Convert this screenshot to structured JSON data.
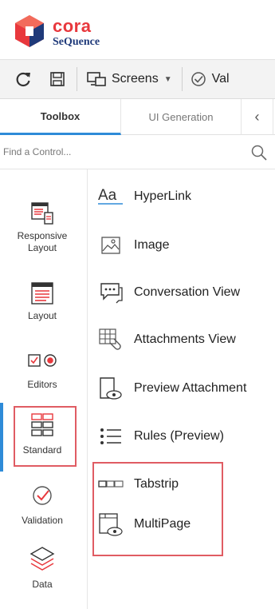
{
  "brand": {
    "name_top": "cora",
    "name_bottom": "SeQuence",
    "logo_color": "#e8383d",
    "name_bottom_color": "#1f3a7a"
  },
  "toolbar": {
    "refresh_icon": "refresh-icon",
    "save_icon": "save-icon",
    "screens_label": "Screens",
    "validate_label": "Val"
  },
  "tabs": [
    {
      "label": "Toolbox",
      "active": true
    },
    {
      "label": "UI Generation",
      "active": false
    }
  ],
  "search": {
    "placeholder": "Find a Control..."
  },
  "categories": [
    {
      "label": "Responsive Layout",
      "icon": "responsive-layout-icon"
    },
    {
      "label": "Layout",
      "icon": "layout-icon"
    },
    {
      "label": "Editors",
      "icon": "editors-icon"
    },
    {
      "label": "Standard",
      "icon": "standard-icon",
      "selected": true
    },
    {
      "label": "Validation",
      "icon": "validation-icon"
    },
    {
      "label": "Data",
      "icon": "data-icon"
    }
  ],
  "controls": [
    {
      "label": "HyperLink",
      "icon": "hyperlink-icon"
    },
    {
      "label": "Image",
      "icon": "image-icon"
    },
    {
      "label": "Conversation View",
      "icon": "conversation-view-icon"
    },
    {
      "label": "Attachments View",
      "icon": "attachments-view-icon"
    },
    {
      "label": "Preview Attachment",
      "icon": "preview-attachment-icon"
    },
    {
      "label": "Rules (Preview)",
      "icon": "rules-icon"
    },
    {
      "label": "Tabstrip",
      "icon": "tabstrip-icon"
    },
    {
      "label": "MultiPage",
      "icon": "multipage-icon"
    }
  ],
  "colors": {
    "accent": "#2e8bd8",
    "highlight": "#e05c63",
    "icon_red": "#e8383d"
  }
}
